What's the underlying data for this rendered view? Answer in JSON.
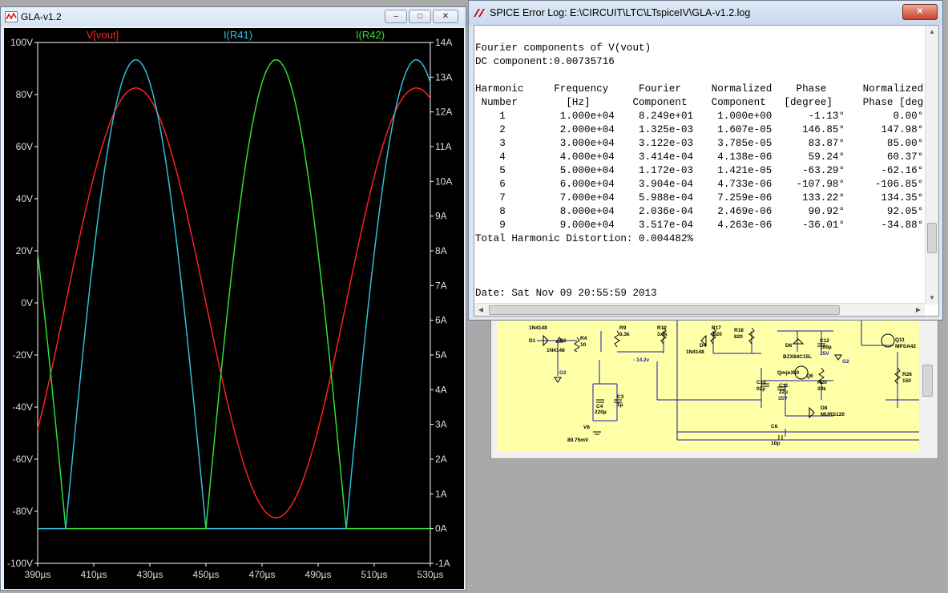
{
  "plot_window": {
    "title": "GLA-v1.2",
    "buttons": {
      "minimize": "‒",
      "restore": "□",
      "close": "✕"
    }
  },
  "log_window": {
    "title": "SPICE Error Log: E:\\CIRCUIT\\LTC\\LTspiceIV\\GLA-v1.2.log",
    "close": "✕",
    "header_line": "Fourier components of V(vout)",
    "dc_line": "DC component:0.00735716",
    "col_head_1": "Harmonic     Frequency     Fourier     Normalized    Phase      Normalized",
    "col_head_2": " Number        [Hz]       Component    Component   [degree]     Phase [deg",
    "rows": [
      "    1         1.000e+04    8.249e+01    1.000e+00      -1.13°        0.00°",
      "    2         2.000e+04    1.325e-03    1.607e-05     146.85°      147.98°",
      "    3         3.000e+04    3.122e-03    3.785e-05      83.87°       85.00°",
      "    4         4.000e+04    3.414e-04    4.138e-06      59.24°       60.37°",
      "    5         5.000e+04    1.172e-03    1.421e-05     -63.29°      -62.16°",
      "    6         6.000e+04    3.904e-04    4.733e-06    -107.98°     -106.85°",
      "    7         7.000e+04    5.988e-04    7.259e-06     133.22°      134.35°",
      "    8         8.000e+04    2.036e-04    2.469e-06      90.92°       92.05°",
      "    9         9.000e+04    3.517e-04    4.263e-06     -36.01°      -34.88°"
    ],
    "thd_line": "Total Harmonic Distortion: 0.004482%",
    "date_line": "Date: Sat Nov 09 20:55:59 2013"
  },
  "schematic": {
    "labels": {
      "d1": "D1",
      "n1": "1N4148",
      "d2": "D2",
      "n2": "1N4148",
      "r4": "R4",
      "r4v": "10",
      "g2a": "G2",
      "r9": "R9",
      "r9v": "3.3k",
      "r10": "R10",
      "r10v": "3.3k",
      "v142": "- 14.2v",
      "c4": "C4",
      "c4v": "220µ",
      "c3": "C3",
      "c3v": "1µ",
      "v6": "V6",
      "v6v": "89.75mV",
      "r17": "R17",
      "r17v": "820",
      "r18": "R18",
      "r18v": "820",
      "d4": "D4",
      "n4": "1N4148",
      "d6": "D6",
      "d6v": "BZX84C15L",
      "c12": "C12",
      "c12v": "100µ",
      "c12w": "35V",
      "g2b": "G2",
      "q11": "Q11",
      "q11v": "MPSA42",
      "qmje": "Qmje350",
      "q6": "Q6",
      "c10": "C10",
      "c10v": "02µ",
      "c11": "C11",
      "c11v": "22µ",
      "c11w": "35V",
      "r20": "R20",
      "r20v": "33k",
      "r26": "R26",
      "r26v": "150",
      "d8": "D8",
      "d8v": "MURS120",
      "c6": "C6",
      "c6v": "10p"
    }
  },
  "chart_data": {
    "type": "line",
    "traces": [
      {
        "name": "V[vout]",
        "color": "#ff2020",
        "axis": "left",
        "kind": "sine",
        "amplitude": 82.5,
        "period_us": 100,
        "peak_at_us": 425,
        "dc": 0
      },
      {
        "name": "I(R41)",
        "color": "#30c0d8",
        "axis": "right",
        "kind": "half-wave",
        "amplitude": 13.5,
        "period_us": 100,
        "peak_at_us": 425,
        "baseline": 0
      },
      {
        "name": "I(R42)",
        "color": "#30e030",
        "axis": "right",
        "kind": "half-wave",
        "amplitude": 13.5,
        "period_us": 100,
        "peak_at_us": 475,
        "baseline": 0
      }
    ],
    "x_range_us": [
      390,
      530
    ],
    "x_ticks": [
      "390µs",
      "410µs",
      "430µs",
      "450µs",
      "470µs",
      "490µs",
      "510µs",
      "530µs"
    ],
    "y_left_range": [
      -100,
      100
    ],
    "y_left_ticks": [
      "100V",
      "80V",
      "60V",
      "40V",
      "20V",
      "0V",
      "-20V",
      "-40V",
      "-60V",
      "-80V",
      "-100V"
    ],
    "y_right_range": [
      -1,
      14
    ],
    "y_right_ticks": [
      "14A",
      "13A",
      "12A",
      "11A",
      "10A",
      "9A",
      "8A",
      "7A",
      "6A",
      "5A",
      "4A",
      "3A",
      "2A",
      "1A",
      "0A",
      "-1A"
    ],
    "background": "#000000",
    "grid": false
  }
}
